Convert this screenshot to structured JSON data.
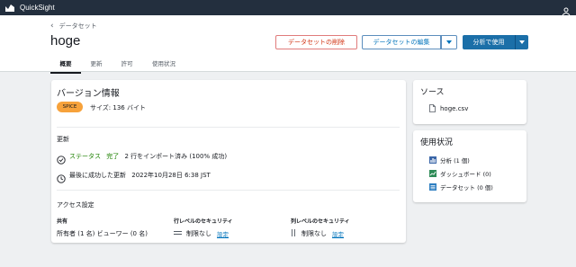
{
  "topbar": {
    "app_name": "QuickSight"
  },
  "header": {
    "breadcrumb": "データセット",
    "title": "hoge",
    "buttons": {
      "delete": "データセットの削除",
      "edit": "データセットの編集",
      "analyze": "分析で使用"
    },
    "tabs": [
      "概要",
      "更新",
      "許可",
      "使用状況"
    ],
    "active_tab": "概要"
  },
  "version_info": {
    "title": "バージョン情報",
    "badge": "SPICE",
    "size": "サイズ: 136 バイト"
  },
  "refresh": {
    "label": "更新",
    "status_label": "ステータス",
    "status_value": "完了",
    "status_detail": "2 行をインポート済み (100% 成功)",
    "last_success": "最後に成功した更新",
    "last_success_time": "2022年10月28日 6:38 JST"
  },
  "access": {
    "label": "アクセス設定",
    "sharing_head": "共有",
    "sharing_value": "所有者 (1 名)  ビューワー (0 名)",
    "row_security_head": "行レベルのセキュリティ",
    "row_security_value": "制限なし",
    "column_security_head": "列レベルのセキュリティ",
    "column_security_value": "制限なし",
    "settings_link": "設定"
  },
  "source": {
    "title": "ソース",
    "file": "hoge.csv"
  },
  "usage": {
    "title": "使用状況",
    "items": [
      "分析 (1 個)",
      "ダッシュボード (0)",
      "データセット (0 個)"
    ]
  },
  "colors": {
    "topbar": "#232f3e",
    "primary": "#1b6fa8",
    "danger": "#d13212",
    "success": "#1d8102",
    "spice_badge": "#f7a23b"
  }
}
